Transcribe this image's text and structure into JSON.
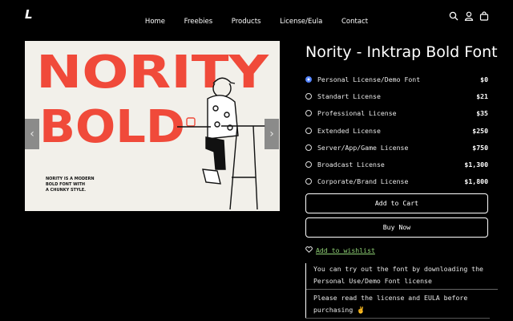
{
  "brand": {
    "logo": "L"
  },
  "nav": {
    "items": [
      "Home",
      "Freebies",
      "Products",
      "License/Eula",
      "Contact"
    ]
  },
  "header_icons": [
    "search-icon",
    "account-icon",
    "cart-icon"
  ],
  "product": {
    "title": "Nority - Inktrap Bold Font",
    "image": {
      "headline_line1": "NORITY",
      "headline_line2": "BOLD",
      "tagline": [
        "NORITY IS A MODERN",
        "BOLD FONT WITH",
        "A CHUNKY STYLE."
      ],
      "accent_color": "#f04a3a"
    },
    "licenses": [
      {
        "name": "Personal License/Demo Font",
        "price": "$0",
        "selected": true
      },
      {
        "name": "Standart License",
        "price": "$21",
        "selected": false
      },
      {
        "name": "Professional License",
        "price": "$35",
        "selected": false
      },
      {
        "name": "Extended License",
        "price": "$250",
        "selected": false
      },
      {
        "name": "Server/App/Game License",
        "price": "$750",
        "selected": false
      },
      {
        "name": "Broadcast License",
        "price": "$1,300",
        "selected": false
      },
      {
        "name": "Corporate/Brand License",
        "price": "$1,800",
        "selected": false
      }
    ],
    "add_to_cart": "Add to Cart",
    "buy_now": "Buy Now",
    "wishlist": "Add to wishlist",
    "note_1": "You can try out the font by downloading the Personal Use/Demo Font license",
    "note_2": "Please read the license and EULA before purchasing ✌️"
  },
  "colors": {
    "background": "#000000",
    "selected_radio": "#4d7fff",
    "wishlist_link": "#8fd175"
  }
}
